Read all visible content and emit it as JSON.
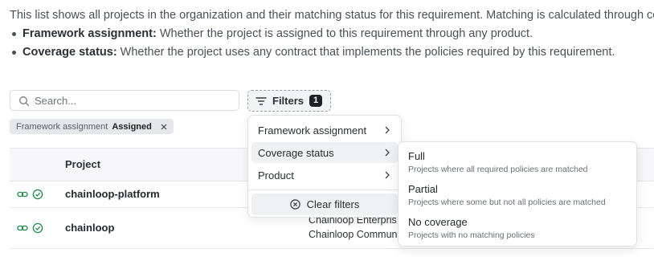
{
  "intro": {
    "paragraph": "This list shows all projects in the organization and their matching status for this requirement. Matching is calculated through contracts that share policies with this requirement.",
    "bullets": [
      {
        "term": "Framework assignment:",
        "text": " Whether the project is assigned to this requirement through any product."
      },
      {
        "term": "Coverage status:",
        "text": " Whether the project uses any contract that implements the policies required by this requirement."
      }
    ]
  },
  "search": {
    "placeholder": "Search...",
    "value": ""
  },
  "filters": {
    "label": "Filters",
    "count": "1"
  },
  "active_filter": {
    "key": "Framework assignment",
    "value": "Assigned"
  },
  "table": {
    "column_project": "Project",
    "rows": [
      {
        "name": "chainloop-platform",
        "contracts": []
      },
      {
        "name": "chainloop",
        "contracts": [
          "Chainloop Enterpris",
          "Chainloop Commun"
        ]
      }
    ]
  },
  "filter_menu": {
    "items": [
      {
        "label": "Framework assignment"
      },
      {
        "label": "Coverage status"
      },
      {
        "label": "Product"
      }
    ],
    "clear_label": "Clear filters"
  },
  "coverage_submenu": {
    "options": [
      {
        "title": "Full",
        "desc": "Projects where all required policies are matched"
      },
      {
        "title": "Partial",
        "desc": "Projects where some but not all policies are matched"
      },
      {
        "title": "No coverage",
        "desc": "Projects with no matching policies"
      }
    ]
  },
  "colors": {
    "link_green": "#1f8a4a",
    "badge_dark": "#1f2125"
  }
}
